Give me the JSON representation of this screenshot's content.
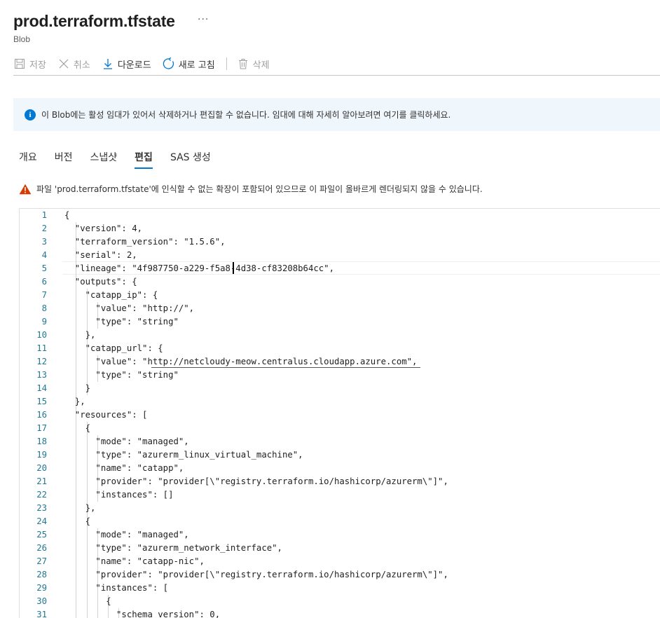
{
  "header": {
    "title": "prod.terraform.tfstate",
    "more": "···",
    "subtitle": "Blob"
  },
  "toolbar": {
    "save": "저장",
    "cancel": "취소",
    "download": "다운로드",
    "refresh": "새로 고침",
    "delete": "삭제"
  },
  "info": {
    "icon": "info-icon",
    "message": "이 Blob에는 활성 임대가 있어서 삭제하거나 편집할 수 없습니다. 임대에 대해 자세히 알아보려면 여기를 클릭하세요."
  },
  "tabs": [
    {
      "label": "개요"
    },
    {
      "label": "버전"
    },
    {
      "label": "스냅샷"
    },
    {
      "label": "편집",
      "active": true
    },
    {
      "label": "SAS 생성"
    }
  ],
  "warning": {
    "icon": "warning-icon",
    "message": "파일 'prod.terraform.tfstate'에 인식할 수 없는 확장이 포함되어 있으므로 이 파일이 올바르게 렌더링되지 않을 수 있습니다."
  },
  "editor": {
    "cursor": {
      "line": 5
    },
    "lines": [
      {
        "n": "1",
        "text": "{"
      },
      {
        "n": "2",
        "text": "  \"version\": 4,"
      },
      {
        "n": "3",
        "text": "  \"terraform_version\": \"1.5.6\","
      },
      {
        "n": "4",
        "text": "  \"serial\": 2,"
      },
      {
        "n": "5",
        "text": "  \"lineage\": \"4f987750-a229-f5a8-4d38-cf83208b64cc\","
      },
      {
        "n": "6",
        "text": "  \"outputs\": {"
      },
      {
        "n": "7",
        "text": "    \"catapp_ip\": {"
      },
      {
        "n": "8",
        "text": "      \"value\": \"http://\","
      },
      {
        "n": "9",
        "text": "      \"type\": \"string\""
      },
      {
        "n": "10",
        "text": "    },"
      },
      {
        "n": "11",
        "text": "    \"catapp_url\": {"
      },
      {
        "n": "12",
        "text": "      \"value\": \"http://netcloudy-meow.centralus.cloudapp.azure.com\","
      },
      {
        "n": "13",
        "text": "      \"type\": \"string\""
      },
      {
        "n": "14",
        "text": "    }"
      },
      {
        "n": "15",
        "text": "  },"
      },
      {
        "n": "16",
        "text": "  \"resources\": ["
      },
      {
        "n": "17",
        "text": "    {"
      },
      {
        "n": "18",
        "text": "      \"mode\": \"managed\","
      },
      {
        "n": "19",
        "text": "      \"type\": \"azurerm_linux_virtual_machine\","
      },
      {
        "n": "20",
        "text": "      \"name\": \"catapp\","
      },
      {
        "n": "21",
        "text": "      \"provider\": \"provider[\\\"registry.terraform.io/hashicorp/azurerm\\\"]\","
      },
      {
        "n": "22",
        "text": "      \"instances\": []"
      },
      {
        "n": "23",
        "text": "    },"
      },
      {
        "n": "24",
        "text": "    {"
      },
      {
        "n": "25",
        "text": "      \"mode\": \"managed\","
      },
      {
        "n": "26",
        "text": "      \"type\": \"azurerm_network_interface\","
      },
      {
        "n": "27",
        "text": "      \"name\": \"catapp-nic\","
      },
      {
        "n": "28",
        "text": "      \"provider\": \"provider[\\\"registry.terraform.io/hashicorp/azurerm\\\"]\","
      },
      {
        "n": "29",
        "text": "      \"instances\": ["
      },
      {
        "n": "30",
        "text": "        {"
      },
      {
        "n": "31",
        "text": "          \"schema_version\": 0,"
      }
    ]
  },
  "colors": {
    "accent": "#0078d4",
    "info_bg": "#eff6fc",
    "warning": "#d83b01",
    "line_number": "#237893"
  }
}
